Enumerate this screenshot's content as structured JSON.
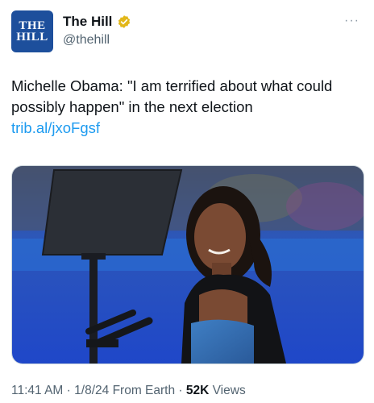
{
  "account": {
    "display_name": "The Hill",
    "handle": "@thehill",
    "avatar_line1": "THE",
    "avatar_line2": "HILL"
  },
  "tweet": {
    "text": "Michelle Obama: \"I am terrified about what could possibly happen\" in the next election",
    "link": "trib.al/jxoFgsf"
  },
  "meta": {
    "time": "11:41 AM",
    "date": "1/8/24",
    "source": "From Earth",
    "views_count": "52K",
    "views_label": "Views",
    "sep": "·"
  },
  "colors": {
    "brand": "#1d4f9c",
    "link": "#1d9bf0",
    "verified": "#e2b719"
  }
}
